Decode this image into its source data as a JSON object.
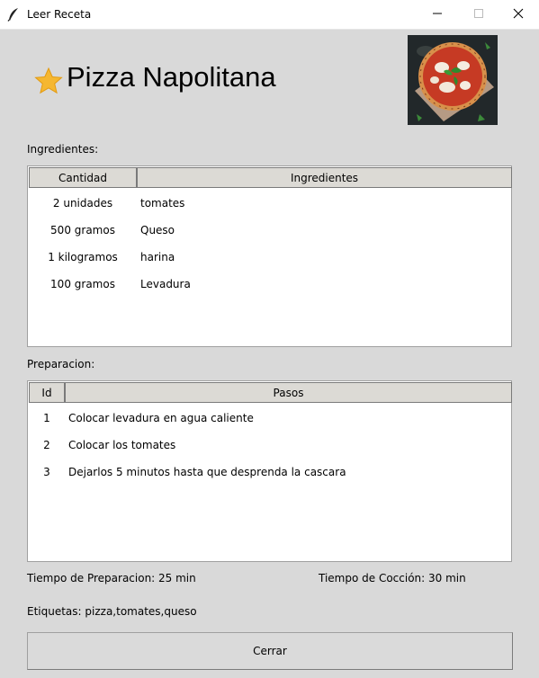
{
  "window": {
    "title": "Leer Receta",
    "icon": "feather-icon",
    "controls": [
      "minimize-icon",
      "maximize-icon",
      "close-icon"
    ]
  },
  "recipe": {
    "favorite_icon": "star-icon",
    "favorite_color": "#f5a623",
    "name": "Pizza Napolitana",
    "photo": "pizza-photo"
  },
  "ingredients": {
    "label": "Ingredientes:",
    "columns": [
      "Cantidad",
      "Ingredientes"
    ],
    "rows": [
      {
        "qty": "2 unidades",
        "name": "tomates"
      },
      {
        "qty": "500 gramos",
        "name": "Queso"
      },
      {
        "qty": "1 kilogramos",
        "name": "harina"
      },
      {
        "qty": "100 gramos",
        "name": "Levadura"
      }
    ]
  },
  "preparation": {
    "label": "Preparacion:",
    "columns": [
      "Id",
      "Pasos"
    ],
    "rows": [
      {
        "id": "1",
        "step": "Colocar levadura en agua caliente"
      },
      {
        "id": "2",
        "step": "Colocar los tomates"
      },
      {
        "id": "3",
        "step": "Dejarlos 5 minutos hasta que desprenda la cascara"
      }
    ]
  },
  "times": {
    "prep": "Tiempo de Preparacion: 25 min",
    "cook": "Tiempo de Cocción: 30 min"
  },
  "tags": "Etiquetas: pizza,tomates,queso",
  "close_button": "Cerrar"
}
